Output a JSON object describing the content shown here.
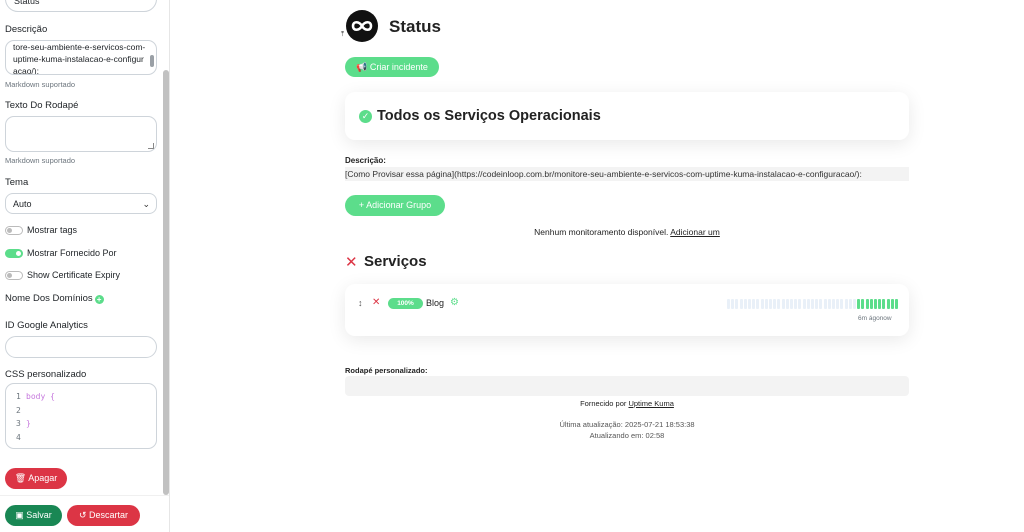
{
  "sidebar": {
    "title_value": "Status",
    "description_label": "Descrição",
    "description_value": "tore-seu-ambiente-e-servicos-com-uptime-kuma-instalacao-e-configuracao/):",
    "markdown_hint_1": "Markdown suportado",
    "footer_text_label": "Texto Do Rodapé",
    "markdown_hint_2": "Markdown suportado",
    "theme_label": "Tema",
    "theme_value": "Auto",
    "toggles": [
      {
        "label": "Mostrar tags",
        "on": false
      },
      {
        "label": "Mostrar Fornecido Por",
        "on": true
      },
      {
        "label": "Show Certificate Expiry",
        "on": false
      }
    ],
    "domain_names_label": "Nome Dos Domínios",
    "ga_label": "ID Google Analytics",
    "css_label": "CSS personalizado",
    "css_lines": [
      {
        "n": "1",
        "code": "body {"
      },
      {
        "n": "2",
        "code": ""
      },
      {
        "n": "3",
        "code": "}"
      },
      {
        "n": "4",
        "code": ""
      }
    ],
    "delete_button": "Apagar",
    "save_button": "Salvar",
    "discard_button": "Descartar"
  },
  "main": {
    "page_title": "Status",
    "create_incident_button": "Criar incidente",
    "overall_status": "Todos os Serviços Operacionais",
    "description_label": "Descrição:",
    "description_text": "[Como Provisar essa página](https://codeinloop.com.br/monitore-seu-ambiente-e-servicos-com-uptime-kuma-instalacao-e-configuracao/):",
    "add_group_button": "Adicionar Grupo",
    "no_monitors_text": "Nenhum monitoramento disponível.",
    "add_one_link": "Adicionar um",
    "group_name": "Serviços",
    "monitor": {
      "uptime_badge": "100%",
      "name": "Blog",
      "last_check": "6m ágonow",
      "beats_empty": 31,
      "beats_up": 10
    },
    "custom_footer_label": "Rodapé personalizado:",
    "powered_by_prefix": "Fornecido por",
    "powered_by_link": "Uptime Kuma",
    "last_update": "Última atualização: 2025-07-21 18:53:38",
    "refresh_in": "Atualizando em: 02:58"
  },
  "colors": {
    "accent_green": "#5cdd8b",
    "danger_red": "#dc3545",
    "save_green": "#198754"
  }
}
